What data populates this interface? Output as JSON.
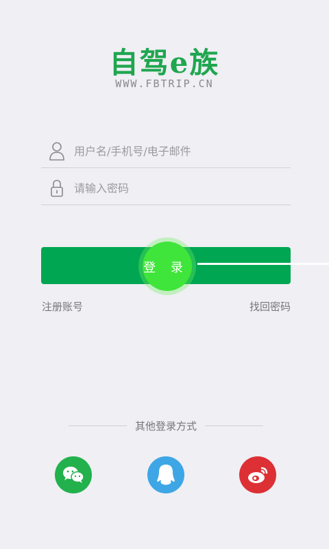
{
  "app": {
    "logo_text": "自驾e族",
    "url_text": "WWW.FBTRIP.CN"
  },
  "form": {
    "username_placeholder": "用户名/手机号/电子邮件",
    "password_placeholder": "请输入密码",
    "login_label": "登 录"
  },
  "links": {
    "register": "注册账号",
    "forgot": "找回密码"
  },
  "social": {
    "heading": "其他登录方式",
    "items": [
      {
        "name": "wechat",
        "icon": "wechat-icon",
        "color": "#22b14c"
      },
      {
        "name": "qq",
        "icon": "qq-icon",
        "color": "#3ea6e5"
      },
      {
        "name": "weibo",
        "icon": "weibo-icon",
        "color": "#dc3035"
      }
    ]
  },
  "colors": {
    "brand_green": "#00a651",
    "background": "#efeff4"
  }
}
